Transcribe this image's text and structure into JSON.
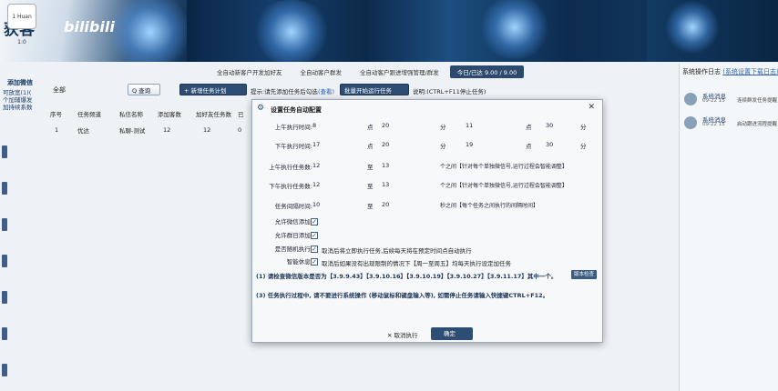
{
  "banner": {
    "logo_text": "获客",
    "logo_brand": "bilibili"
  },
  "leftbar": {
    "avatar_label": "1 Huan 1:0",
    "add_friend": "添加微信",
    "lines": [
      "可放宽(1)(",
      "个加辅爆发",
      "加持续系数"
    ]
  },
  "tabs": [
    "全自动新客户开发加好友",
    "全自动客户群发",
    "全自动客户跟进增强管理/群发",
    "今日/已达 9.00 / 9.00"
  ],
  "toolbar": {
    "all_label": "全部",
    "search_label": "Q 查询",
    "add_label": "+ 新增任务计划",
    "tip_text": "提示:请先添加任务后勾选",
    "tip_link": "(查看)",
    "start_label": "批量开始运行任务",
    "hint": "说明:(CTRL+F11停止任务)"
  },
  "table": {
    "headers": [
      "序号",
      "任务频道",
      "私信名称",
      "添加客数",
      "加好友任务数",
      "已"
    ],
    "rows": [
      [
        "1",
        "优达",
        "私聊-测试",
        "12",
        "12",
        "0"
      ]
    ]
  },
  "right_panel": {
    "title": "系统操作日志",
    "link": "(系统设置下载日志)",
    "messages": [
      {
        "title": "系统消息",
        "date": "09-22 15",
        "preview": "连续群发任务提醒"
      },
      {
        "title": "系统消息",
        "date": "09-22 15",
        "preview": "启动跟进流程提醒"
      }
    ]
  },
  "dialog": {
    "title": "设置任务自动配置",
    "am_label": "上午执行时间:",
    "am_h1": "8",
    "am_sep": "点",
    "am_h2": "20",
    "am_m_unit": "分",
    "am_m1": "11",
    "am_to_unit": "点",
    "am_m2": "30",
    "am_end_unit": "分",
    "pm_label": "下午执行时间:",
    "pm_h1": "17",
    "pm_sep": "点",
    "pm_h2": "20",
    "pm_m_unit": "分",
    "pm_m1": "19",
    "pm_to_unit": "点",
    "pm_m2": "30",
    "pm_end_unit": "分",
    "am_tasks_label": "上午执行任务数:",
    "am_tasks_min": "12",
    "am_tasks_to": "至",
    "am_tasks_max": "13",
    "am_tasks_note": "个之间【针对每个单独微信号,运行过程会智能调整】",
    "pm_tasks_label": "下午执行任务数:",
    "pm_tasks_min": "12",
    "pm_tasks_to": "至",
    "pm_tasks_max": "13",
    "pm_tasks_note": "个之间【针对每个单独微信号,运行过程会智能调整】",
    "interval_label": "任务间隔时间:",
    "interval_min": "10",
    "interval_to": "至",
    "interval_max": "20",
    "interval_note": "秒之间【每个任务之间执行的间隔时间】",
    "cb1_label": "允许微信添加:",
    "cb2_label": "允许群日添加:",
    "cb3_label": "是否随机执行:",
    "cb3_text": "取消后将立即执行任务,后续每天将在预定时间点自动执行",
    "cb4_label": "智能休息:",
    "cb4_text": "取消后如果没有出现限制的情况下【周一至周五】均每天执行设定加任务",
    "warn1": "(1) 请检查微信版本是否为【3.9.9.43】【3.9.10.16】【3.9.10.19】【3.9.10.27】【3.9.11.17】其中一个。",
    "ver_btn": "版本检查",
    "warn2": "(3) 任务执行过程中, 请不要进行系统操作 (移动鼠标和键盘输入等), 如需停止任务请输入快捷键CTRL+F12。",
    "cancel": "取消执行",
    "ok": "确定"
  }
}
